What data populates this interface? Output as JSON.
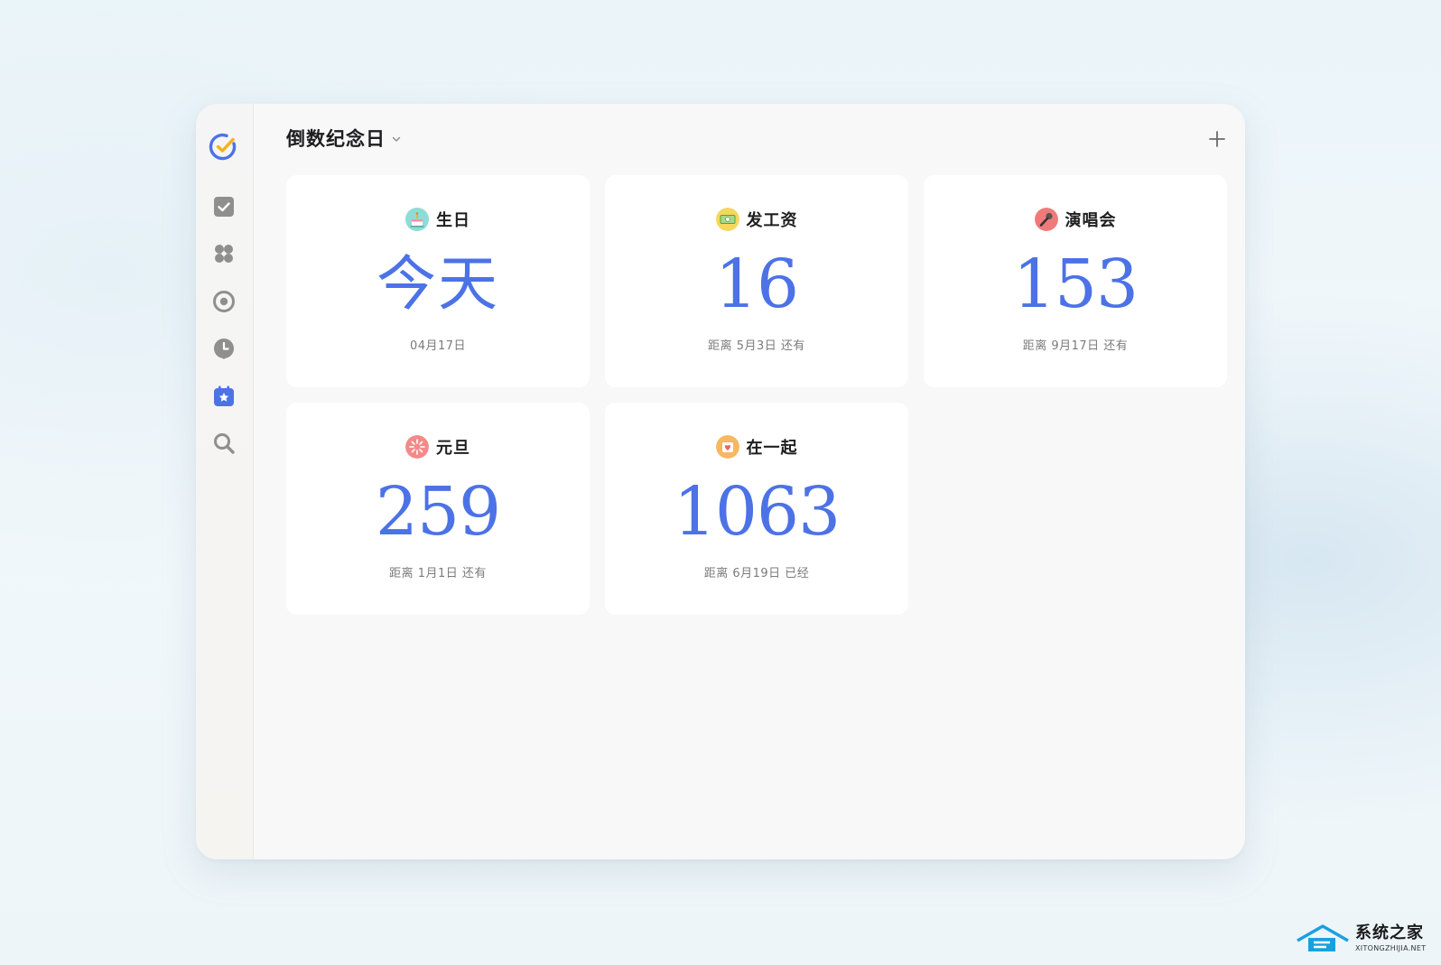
{
  "header": {
    "title": "倒数纪念日"
  },
  "sidebar": {
    "items": [
      {
        "icon": "app-logo-icon",
        "active": false
      },
      {
        "icon": "task-checkbox-icon",
        "active": false
      },
      {
        "icon": "matrix-icon",
        "active": false
      },
      {
        "icon": "focus-target-icon",
        "active": false
      },
      {
        "icon": "pomodoro-clock-icon",
        "active": false
      },
      {
        "icon": "countdown-calendar-icon",
        "active": true
      },
      {
        "icon": "search-icon",
        "active": false
      }
    ]
  },
  "cards": [
    {
      "name": "生日",
      "count": "今天",
      "desc": "04月17日",
      "icon": "cake-icon",
      "icon_bg": "#7fd8d4"
    },
    {
      "name": "发工资",
      "count": "16",
      "desc": "距离 5月3日 还有",
      "icon": "money-icon",
      "icon_bg": "#f5d75c"
    },
    {
      "name": "演唱会",
      "count": "153",
      "desc": "距离 9月17日 还有",
      "icon": "microphone-icon",
      "icon_bg": "#f07a7a"
    },
    {
      "name": "元旦",
      "count": "259",
      "desc": "距离 1月1日 还有",
      "icon": "firework-icon",
      "icon_bg": "#f38a8a"
    },
    {
      "name": "在一起",
      "count": "1063",
      "desc": "距离 6月19日 已经",
      "icon": "heart-box-icon",
      "icon_bg": "#f6b860"
    }
  ],
  "colors": {
    "accent": "#4c72e6",
    "count_text": "#4c72e6",
    "sidebar_icon": "#9a9a9a"
  },
  "watermark": {
    "cn": "系统之家",
    "en": "XITONGZHIJIA.NET"
  }
}
